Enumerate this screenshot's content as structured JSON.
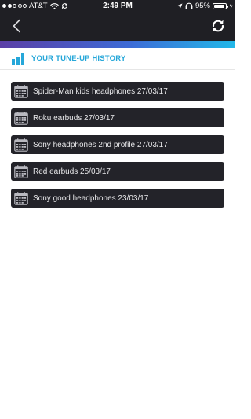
{
  "status_bar": {
    "carrier": "AT&T",
    "time": "2:49 PM",
    "battery": "95%",
    "battery_level": 0.95,
    "icons": [
      "wifi-icon",
      "sync-icon",
      "location-arrow-icon",
      "headphones-icon",
      "charging-icon"
    ]
  },
  "nav": {
    "back_icon": "chevron-left-icon",
    "refresh_icon": "refresh-icon"
  },
  "section": {
    "title": "YOUR TUNE-UP HISTORY",
    "icon": "bar-chart-icon"
  },
  "history": {
    "item_icon": "calendar-icon",
    "items": [
      {
        "label": "Spider-Man kids headphones 27/03/17"
      },
      {
        "label": "Roku earbuds 27/03/17"
      },
      {
        "label": "Sony headphones 2nd profile 27/03/17"
      },
      {
        "label": "Red earbuds  25/03/17"
      },
      {
        "label": "Sony good headphones 23/03/17"
      }
    ]
  },
  "colors": {
    "header_bg": "#1f1f24",
    "accent": "#26a7d9",
    "item_bg": "#232329",
    "gradient_start": "#5b3fa6",
    "gradient_end": "#22b8e8"
  }
}
